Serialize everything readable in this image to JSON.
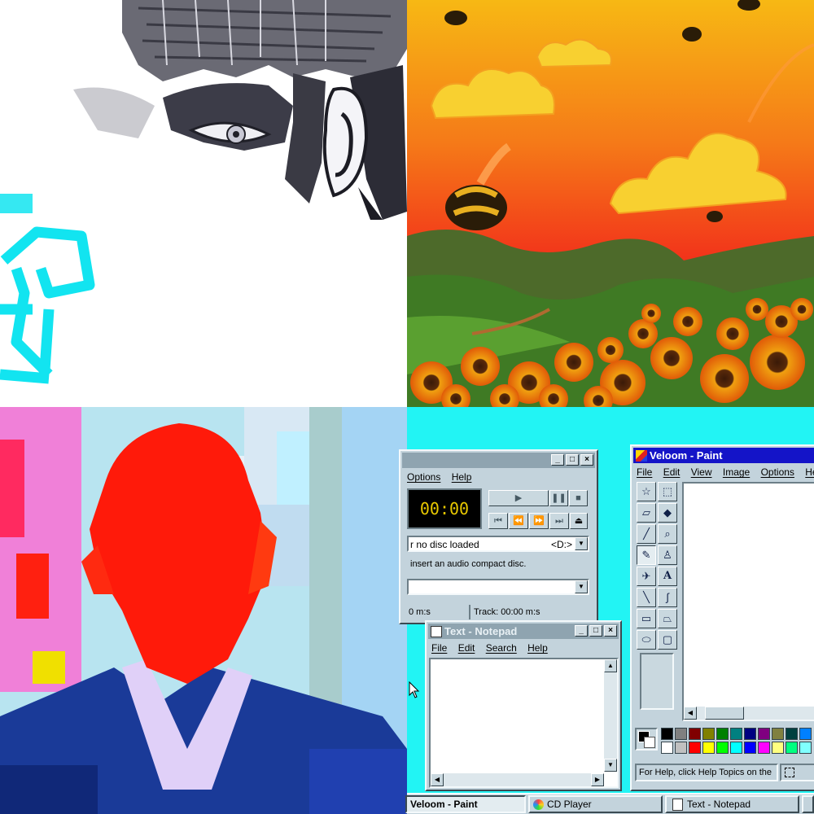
{
  "colors": {
    "desktop": "#22f4f4",
    "title_active": "#1414c8",
    "title_inactive": "#8fa4b0",
    "window_face": "#c3d3dc",
    "cd_display_bg": "#000000",
    "cd_display_text": "#e8c800"
  },
  "cd_player": {
    "menu": [
      "Options",
      "Help"
    ],
    "time_display": "00:00",
    "play_icon": "play-icon",
    "artist_value": "r no disc loaded",
    "drive_value": "<D:>",
    "title_value": "insert an audio compact disc.",
    "status_total": "0 m:s",
    "status_track": "Track: 00:00 m:s"
  },
  "notepad": {
    "title": "Text - Notepad",
    "menu": [
      "File",
      "Edit",
      "Search",
      "Help"
    ]
  },
  "paint": {
    "title": "Veloom - Paint",
    "menu": [
      "File",
      "Edit",
      "View",
      "Image",
      "Options",
      "Help"
    ],
    "status": "For Help, click Help Topics on the",
    "tools": [
      "free-select-icon",
      "rect-select-icon",
      "eraser-icon",
      "fill-bucket-icon",
      "color-picker-icon",
      "magnifier-icon",
      "pencil-icon",
      "brush-icon",
      "airbrush-icon",
      "text-icon",
      "line-icon",
      "curve-icon",
      "rectangle-icon",
      "polygon-icon",
      "ellipse-icon",
      "rounded-rect-icon"
    ],
    "text_tool_label": "A",
    "palette": [
      "#000000",
      "#808080",
      "#800000",
      "#808000",
      "#008000",
      "#008080",
      "#000080",
      "#800080",
      "#808040",
      "#004040",
      "#0080ff",
      "#ffffff",
      "#c0c0c0",
      "#ff0000",
      "#ffff00",
      "#00ff00",
      "#00ffff",
      "#0000ff",
      "#ff00ff",
      "#ffff80",
      "#00ff80",
      "#80ffff"
    ]
  },
  "taskbar": {
    "paint": "Veloom - Paint",
    "cd_player": "CD Player",
    "notepad": "Text - Notepad"
  },
  "collage": {
    "top_left": "glitched-anime-face-image",
    "top_right": "sunflower-field-bees-painting",
    "bottom_left": "glitched-portrait-man-image"
  }
}
